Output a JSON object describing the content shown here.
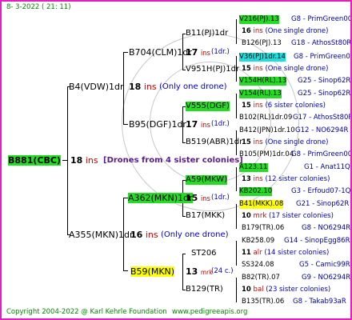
{
  "date": "8-  3-2022 ( 21: 11)",
  "footer": {
    "copyright": "Copyright 2004-2022 @ Karl Kehrle Foundation",
    "site": "www.pedigreeapis.org"
  },
  "colors": {
    "border": "#e020c0",
    "hl_green": "#22dd22",
    "hl_yellow": "#ffff00",
    "hl_cyan": "#22dddd",
    "note_blue": "#0000cc"
  },
  "root": {
    "name": "B881(CBC)",
    "ins": "18",
    "ins_word": "ins",
    "note": "[Drones from 4 sister colonies]"
  },
  "g1": {
    "top": {
      "name": "B4(VDW)1dr",
      "ins": "18",
      "ins_word": "ins",
      "note": "(Only one drone)"
    },
    "bottom": {
      "name": "A355(MKN)1dr",
      "ins": "16",
      "ins_word": "ins",
      "note": "(Only one drone)"
    }
  },
  "g2": [
    {
      "name": "B704(CLM)1dr",
      "ins": "17",
      "ins_word": "ins",
      "note": "(1dr.)"
    },
    {
      "name": "B95(DGF)1dr",
      "ins": "17",
      "ins_word": "ins",
      "note": "(1dr.)"
    },
    {
      "name": "A362(MKN)1dr",
      "ins": "15",
      "ins_word": "ins",
      "note": "(1dr.)"
    },
    {
      "name": "B59(MKN)",
      "ins": "13",
      "ins_word": "mrk",
      "note": "(24 c.)"
    }
  ],
  "g3": [
    {
      "name": "B11(PJ)1dr"
    },
    {
      "name": "V951H(PJ)1dr"
    },
    {
      "name": "V555(DGF)"
    },
    {
      "name": "B519(ABR)1dr"
    },
    {
      "name": "A59(MKW)"
    },
    {
      "name": "B17(MKK)"
    },
    {
      "name": "ST206"
    },
    {
      "name": "B129(TR)"
    }
  ],
  "g4": [
    {
      "name": "V216(PJ).13",
      "ref": "G8 - PrimGreen00"
    },
    {
      "num": "16",
      "word": "ins",
      "note": "(One single drone)"
    },
    {
      "name": "B126(PJ).13",
      "ref": "G18 - AthosSt80R"
    },
    {
      "name": "V36(PJ)1dr.14",
      "ref": "G8 - PrimGreen00"
    },
    {
      "num": "15",
      "word": "ins",
      "note": "(One single drone)"
    },
    {
      "name": "V154H(RL).13",
      "ref": "G25 - Sinop62R"
    },
    {
      "name": "V154(RL).13",
      "ref": "G25 - Sinop62R"
    },
    {
      "num": "15",
      "word": "ins",
      "note": "(6 sister colonies)"
    },
    {
      "name": "B102(RL)1dr.09",
      "ref": "G17 - AthosSt80R"
    },
    {
      "name": "B412(JPN)1dr.10",
      "ref": "G12 - NO6294R"
    },
    {
      "num": "15",
      "word": "ins",
      "note": "(One single drone)"
    },
    {
      "name": "B105(PM)1dr.04",
      "ref": "G8 - PrimGreen00"
    },
    {
      "name": "A123.11",
      "ref": "G1 - Anat11Q"
    },
    {
      "num": "13",
      "word": "ins",
      "note": "(12 sister colonies)"
    },
    {
      "name": "KB202.10",
      "ref": "G3 - Erfoud07-1Q"
    },
    {
      "name": "B41(MKK).08",
      "ref": "G21 - Sinop62R"
    },
    {
      "num": "10",
      "word": "mrk",
      "note": "(17 sister colonies)"
    },
    {
      "name": "B179(TR).06",
      "ref": "G8 - NO6294R"
    },
    {
      "name": "KB258.09",
      "ref": "G14 - SinopEgg86R"
    },
    {
      "num": "11",
      "word": "alr",
      "note": "(14 sister colonies)"
    },
    {
      "name": "SS324.08",
      "ref": "G5 - Camic99R"
    },
    {
      "name": "B82(TR).07",
      "ref": "G9 - NO6294R"
    },
    {
      "num": "10",
      "word": "bal",
      "note": "(23 sister colonies)"
    },
    {
      "name": "B135(TR).06",
      "ref": "G8 - Takab93aR"
    }
  ]
}
